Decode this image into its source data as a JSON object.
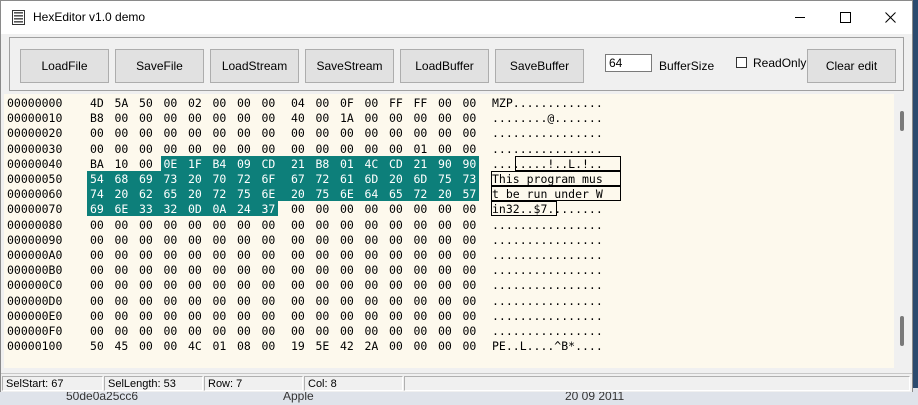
{
  "window": {
    "title": "HexEditor v1.0 demo"
  },
  "toolbar": {
    "buttons": [
      "LoadFile",
      "SaveFile",
      "LoadStream",
      "SaveStream",
      "LoadBuffer",
      "SaveBuffer"
    ],
    "buffer_size_value": "64",
    "buffer_size_label": "BufferSize",
    "readonly_label": "ReadOnly",
    "readonly_checked": false,
    "clear_label": "Clear edit"
  },
  "hex_view": {
    "selection": {
      "start": 67,
      "length": 53
    },
    "rows": [
      {
        "addr": "00000000",
        "bytes": [
          "4D",
          "5A",
          "50",
          "00",
          "02",
          "00",
          "00",
          "00",
          "04",
          "00",
          "0F",
          "00",
          "FF",
          "FF",
          "00",
          "00"
        ],
        "ascii": "MZP............."
      },
      {
        "addr": "00000010",
        "bytes": [
          "B8",
          "00",
          "00",
          "00",
          "00",
          "00",
          "00",
          "00",
          "40",
          "00",
          "1A",
          "00",
          "00",
          "00",
          "00",
          "00"
        ],
        "ascii": "........@......."
      },
      {
        "addr": "00000020",
        "bytes": [
          "00",
          "00",
          "00",
          "00",
          "00",
          "00",
          "00",
          "00",
          "00",
          "00",
          "00",
          "00",
          "00",
          "00",
          "00",
          "00"
        ],
        "ascii": "................"
      },
      {
        "addr": "00000030",
        "bytes": [
          "00",
          "00",
          "00",
          "00",
          "00",
          "00",
          "00",
          "00",
          "00",
          "00",
          "00",
          "00",
          "00",
          "01",
          "00",
          "00"
        ],
        "ascii": "................"
      },
      {
        "addr": "00000040",
        "bytes": [
          "BA",
          "10",
          "00",
          "0E",
          "1F",
          "B4",
          "09",
          "CD",
          "21",
          "B8",
          "01",
          "4C",
          "CD",
          "21",
          "90",
          "90"
        ],
        "ascii": "........!..L.!.."
      },
      {
        "addr": "00000050",
        "bytes": [
          "54",
          "68",
          "69",
          "73",
          "20",
          "70",
          "72",
          "6F",
          "67",
          "72",
          "61",
          "6D",
          "20",
          "6D",
          "75",
          "73"
        ],
        "ascii": "This program mus"
      },
      {
        "addr": "00000060",
        "bytes": [
          "74",
          "20",
          "62",
          "65",
          "20",
          "72",
          "75",
          "6E",
          "20",
          "75",
          "6E",
          "64",
          "65",
          "72",
          "20",
          "57"
        ],
        "ascii": "t be run under W"
      },
      {
        "addr": "00000070",
        "bytes": [
          "69",
          "6E",
          "33",
          "32",
          "0D",
          "0A",
          "24",
          "37",
          "00",
          "00",
          "00",
          "00",
          "00",
          "00",
          "00",
          "00"
        ],
        "ascii": "in32..$7........"
      },
      {
        "addr": "00000080",
        "bytes": [
          "00",
          "00",
          "00",
          "00",
          "00",
          "00",
          "00",
          "00",
          "00",
          "00",
          "00",
          "00",
          "00",
          "00",
          "00",
          "00"
        ],
        "ascii": "................"
      },
      {
        "addr": "00000090",
        "bytes": [
          "00",
          "00",
          "00",
          "00",
          "00",
          "00",
          "00",
          "00",
          "00",
          "00",
          "00",
          "00",
          "00",
          "00",
          "00",
          "00"
        ],
        "ascii": "................"
      },
      {
        "addr": "000000A0",
        "bytes": [
          "00",
          "00",
          "00",
          "00",
          "00",
          "00",
          "00",
          "00",
          "00",
          "00",
          "00",
          "00",
          "00",
          "00",
          "00",
          "00"
        ],
        "ascii": "................"
      },
      {
        "addr": "000000B0",
        "bytes": [
          "00",
          "00",
          "00",
          "00",
          "00",
          "00",
          "00",
          "00",
          "00",
          "00",
          "00",
          "00",
          "00",
          "00",
          "00",
          "00"
        ],
        "ascii": "................"
      },
      {
        "addr": "000000C0",
        "bytes": [
          "00",
          "00",
          "00",
          "00",
          "00",
          "00",
          "00",
          "00",
          "00",
          "00",
          "00",
          "00",
          "00",
          "00",
          "00",
          "00"
        ],
        "ascii": "................"
      },
      {
        "addr": "000000D0",
        "bytes": [
          "00",
          "00",
          "00",
          "00",
          "00",
          "00",
          "00",
          "00",
          "00",
          "00",
          "00",
          "00",
          "00",
          "00",
          "00",
          "00"
        ],
        "ascii": "................"
      },
      {
        "addr": "000000E0",
        "bytes": [
          "00",
          "00",
          "00",
          "00",
          "00",
          "00",
          "00",
          "00",
          "00",
          "00",
          "00",
          "00",
          "00",
          "00",
          "00",
          "00"
        ],
        "ascii": "................"
      },
      {
        "addr": "000000F0",
        "bytes": [
          "00",
          "00",
          "00",
          "00",
          "00",
          "00",
          "00",
          "00",
          "00",
          "00",
          "00",
          "00",
          "00",
          "00",
          "00",
          "00"
        ],
        "ascii": "................"
      },
      {
        "addr": "00000100",
        "bytes": [
          "50",
          "45",
          "00",
          "00",
          "4C",
          "01",
          "08",
          "00",
          "19",
          "5E",
          "42",
          "2A",
          "00",
          "00",
          "00",
          "00"
        ],
        "ascii": "PE..L....^B*...."
      }
    ]
  },
  "statusbar": {
    "selstart": "SelStart: 67",
    "sellength": "SelLength: 53",
    "row": "Row: 7",
    "col": "Col: 8"
  },
  "background_peek": {
    "cell_1": "50de0a25cc6",
    "cell_2": "Apple",
    "cell_3": "20 09 2011"
  },
  "colors": {
    "selection": "#0d7f7a",
    "editor_bg": "#fdf9ed",
    "chrome": "#f0f0f0"
  },
  "icons": [
    "app-icon",
    "minimize-icon",
    "maximize-icon",
    "close-icon",
    "checkbox-icon"
  ]
}
